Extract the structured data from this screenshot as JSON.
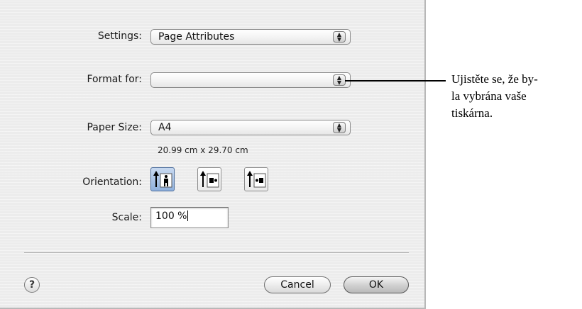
{
  "dialog": {
    "settings": {
      "label": "Settings:",
      "value": "Page Attributes"
    },
    "format_for": {
      "label": "Format for:",
      "value": ""
    },
    "paper_size": {
      "label": "Paper Size:",
      "value": "A4",
      "dimensions": "20.99 cm x 29.70 cm"
    },
    "orientation": {
      "label": "Orientation:",
      "options": [
        "portrait",
        "landscape-left",
        "landscape-right"
      ],
      "selected": "portrait"
    },
    "scale": {
      "label": "Scale:",
      "value": "100 %"
    },
    "help_label": "?",
    "cancel_label": "Cancel",
    "ok_label": "OK"
  },
  "callout": {
    "lines": [
      "Ujistěte se, že by-",
      "la vybrána vaše",
      "tiskárna."
    ]
  }
}
